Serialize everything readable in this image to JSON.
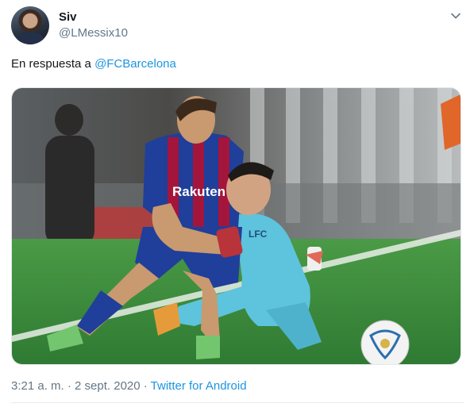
{
  "tweet": {
    "display_name": "Siv",
    "handle": "@LMessix10",
    "reply_prefix": "En respuesta a",
    "reply_mention": "@FCBarcelona",
    "timestamp": "3:21 a. m. · 2 sept. 2020",
    "separator": " · ",
    "source": "Twitter for Android",
    "menu_icon": "chevron-down-icon"
  },
  "media": {
    "jersey_text": "Rakuten",
    "shirt_text": "LFC",
    "colors": {
      "pitch": "#3a8a3c",
      "barca_blue": "#1f3f9a",
      "barca_red": "#a4153c",
      "opponent_cyan": "#5ec3dc"
    }
  }
}
